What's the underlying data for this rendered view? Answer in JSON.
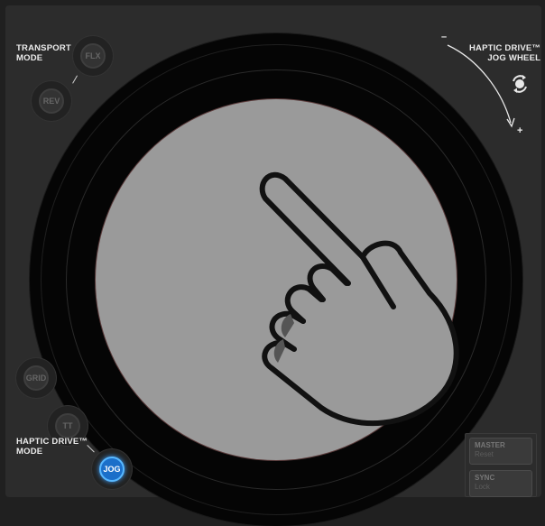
{
  "labels": {
    "transport_mode": "TRANSPORT\nMODE",
    "haptic_drive_jog_wheel": "HAPTIC DRIVE™\nJOG WHEEL",
    "haptic_drive_mode": "HAPTIC DRIVE™\nMODE",
    "minus": "–",
    "plus": "+"
  },
  "buttons": {
    "flx": "FLX",
    "rev": "REV",
    "grid": "GRID",
    "tt": "TT",
    "jog": "JOG"
  },
  "right_buttons": {
    "master": "MASTER",
    "master_sub": "Reset",
    "sync": "SYNC",
    "sync_sub": "Lock"
  },
  "icons": {
    "jog_wheel": "hand-touch-icon",
    "rotate": "rotate-arrows-icon"
  },
  "colors": {
    "jog_active": "#1b6fc9",
    "platter": "#9a9a9a"
  }
}
